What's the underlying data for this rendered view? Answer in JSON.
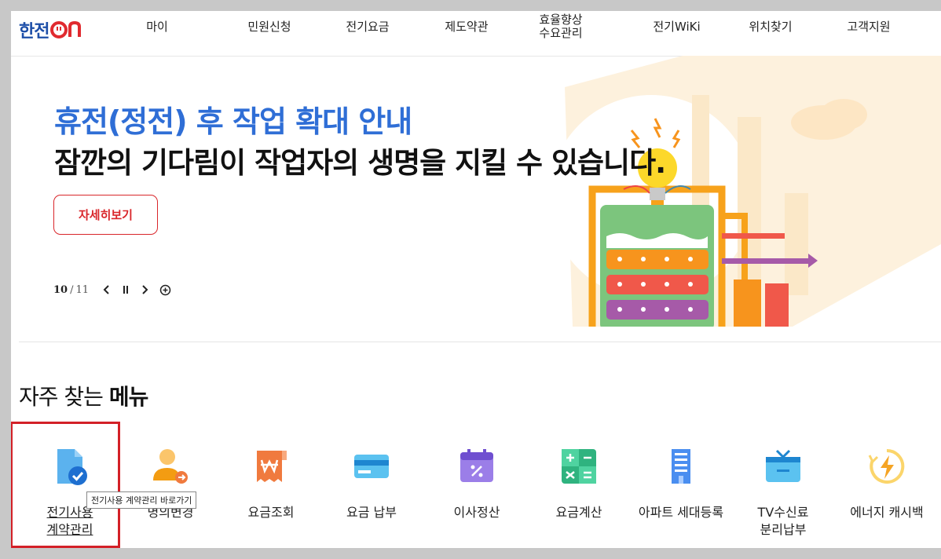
{
  "header": {
    "logo_text": "한전",
    "nav": [
      "마이",
      "민원신청",
      "전기요금",
      "제도약관",
      "효율향상\n수요관리",
      "전기WiKi",
      "위치찾기",
      "고객지원"
    ]
  },
  "hero": {
    "title": "휴전(정전) 후 작업 확대 안내",
    "subtitle": "잠깐의 기다림이 작업자의 생명을 지킬 수 있습니다.",
    "more_label": "자세히보기",
    "pager": {
      "current": "10",
      "separator": "/",
      "total": "11"
    }
  },
  "favorites": {
    "title_prefix": "자주 찾는 ",
    "title_bold": "메뉴",
    "items": [
      {
        "label": "전기사용\n계약관리",
        "icon": "document-check-icon",
        "color": "#3a9ae8"
      },
      {
        "label": "명의변경",
        "icon": "person-change-icon",
        "color": "#f39c12"
      },
      {
        "label": "요금조회",
        "icon": "receipt-won-icon",
        "color": "#f07a3e"
      },
      {
        "label": "요금 납부",
        "icon": "credit-card-icon",
        "color": "#3aa8e8"
      },
      {
        "label": "이사정산",
        "icon": "calendar-percent-icon",
        "color": "#8e6bd8"
      },
      {
        "label": "요금계산",
        "icon": "calculator-icon",
        "color": "#2fb37f"
      },
      {
        "label": "아파트 세대등록",
        "icon": "apartment-icon",
        "color": "#3a7ee8"
      },
      {
        "label": "TV수신료\n분리납부",
        "icon": "tv-icon",
        "color": "#3ab0e8"
      },
      {
        "label": "에너지 캐시백",
        "icon": "energy-cashback-icon",
        "color": "#f5b324"
      }
    ],
    "tooltip": "전기사용 계약관리 바로가기"
  },
  "colors": {
    "accent_blue": "#2f6ed6",
    "brand_red": "#d9262b",
    "logo_blue": "#1e4fa8"
  }
}
